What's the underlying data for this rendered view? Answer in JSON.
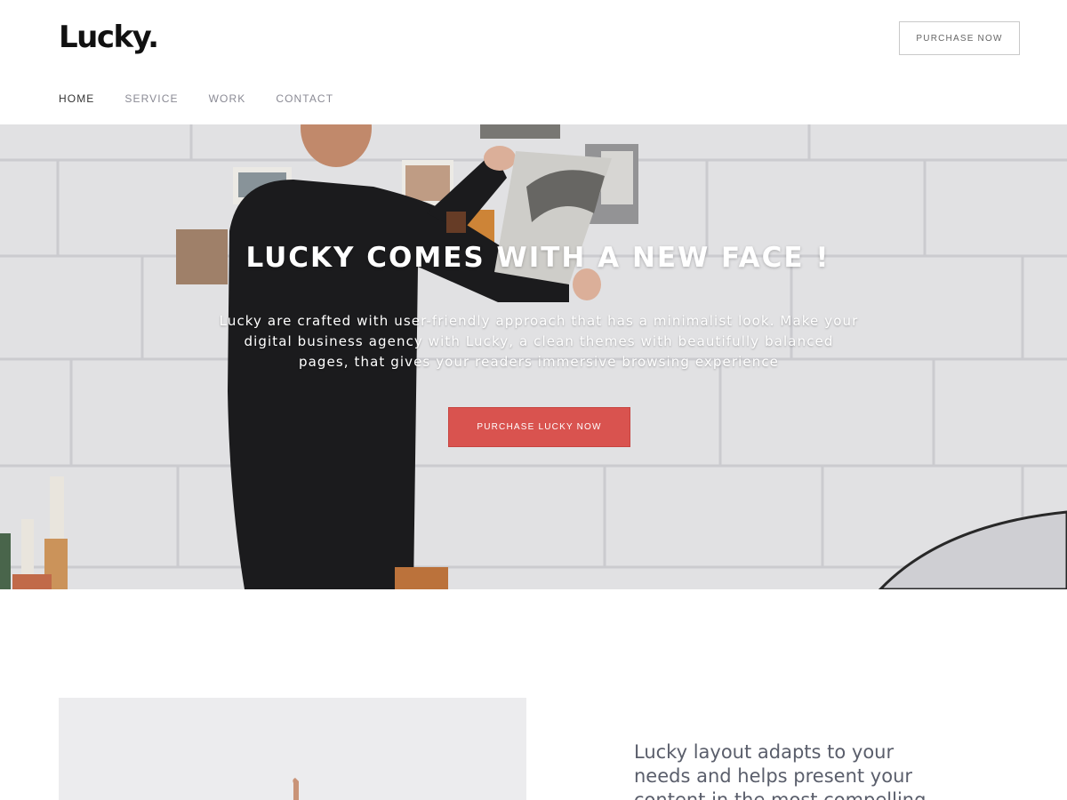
{
  "header": {
    "logo": "Lucky.",
    "purchase_button": "PURCHASE NOW",
    "nav": [
      "HOME",
      "SERVICE",
      "WORK",
      "CONTACT"
    ]
  },
  "hero": {
    "title": "LUCKY COMES WITH A NEW FACE !",
    "description": "Lucky are crafted with user-friendly approach that has a minimalist look. Make your digital business agency with Lucky, a clean themes with beautifully balanced pages, that gives your readers immersive browsing experience",
    "cta_button": "PURCHASE LUCKY NOW"
  },
  "feature": {
    "text": "Lucky layout adapts to your needs and helps present your content in the most compelling way"
  },
  "colors": {
    "accent": "#d9534f",
    "nav_text": "#8a8a94",
    "heading_text": "#5a5e6b"
  }
}
